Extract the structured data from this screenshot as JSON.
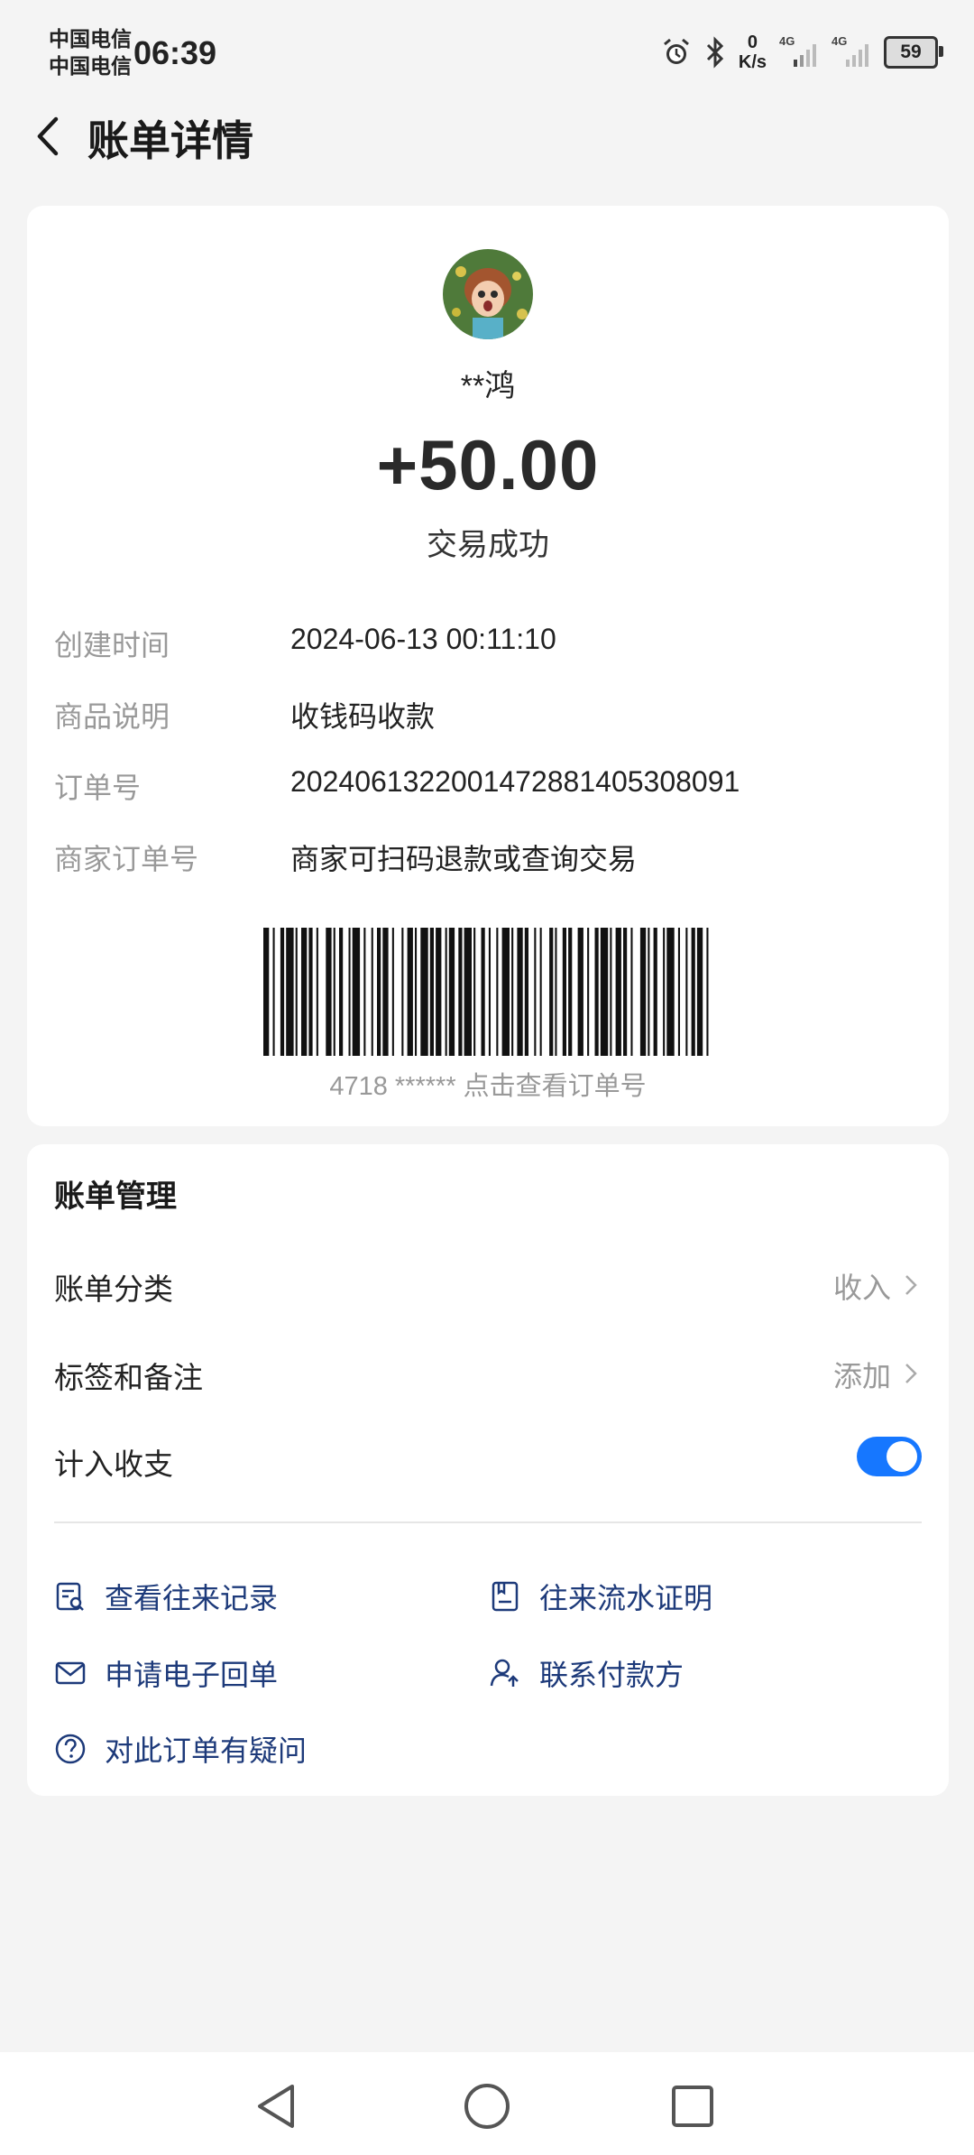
{
  "status_bar": {
    "carrier_1": "中国电信",
    "carrier_2": "中国电信",
    "time": "06:39",
    "net_speed_value": "0",
    "net_speed_unit": "K/s",
    "signal_1": "4G",
    "signal_2": "4G",
    "battery": "59"
  },
  "header": {
    "title": "账单详情"
  },
  "transaction": {
    "payer": "**鸿",
    "amount": "+50.00",
    "status": "交易成功",
    "details": [
      {
        "label": "创建时间",
        "value": "2024-06-13 00:11:10"
      },
      {
        "label": "商品说明",
        "value": "收钱码收款"
      },
      {
        "label": "订单号",
        "value": "2024061322001472881405308091"
      },
      {
        "label": "商家订单号",
        "value": "商家可扫码退款或查询交易"
      }
    ],
    "barcode_caption": "4718 ****** 点击查看订单号"
  },
  "management": {
    "title": "账单管理",
    "category_label": "账单分类",
    "category_value": "收入",
    "tags_label": "标签和备注",
    "tags_value": "添加",
    "include_label": "计入收支",
    "include_on": true,
    "links": {
      "records": "查看往来记录",
      "statement": "往来流水证明",
      "receipt": "申请电子回单",
      "contact": "联系付款方",
      "question": "对此订单有疑问"
    }
  },
  "colors": {
    "accent": "#1677ff",
    "link_text": "#1d3a7a",
    "label_gray": "#999999",
    "background": "#f4f4f4"
  },
  "icons": [
    "back-arrow-icon",
    "alarm-icon",
    "bluetooth-icon",
    "signal-icon",
    "battery-icon",
    "chevron-right-icon",
    "records-icon",
    "statement-icon",
    "mail-icon",
    "contact-icon",
    "question-icon",
    "nav-back-icon",
    "nav-home-icon",
    "nav-recents-icon"
  ]
}
